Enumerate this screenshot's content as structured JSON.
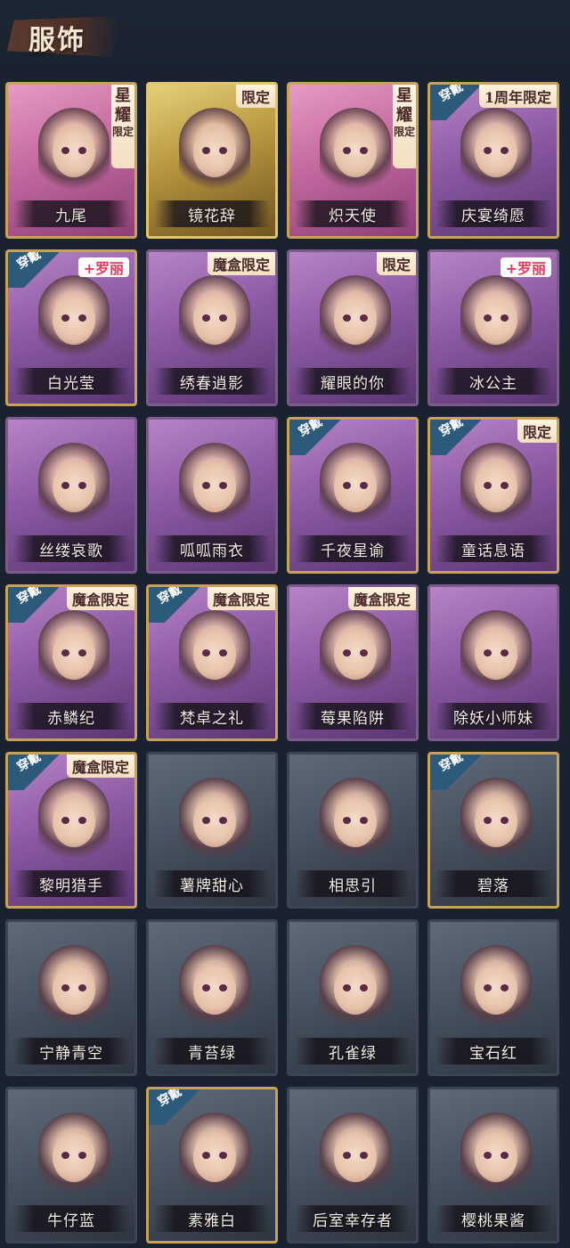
{
  "page": {
    "title": "服饰"
  },
  "cards": [
    {
      "name": "九尾",
      "style": "c-pink",
      "badge": "星耀限定"
    },
    {
      "name": "镜花辞",
      "style": "c-gold",
      "badge": "限定"
    },
    {
      "name": "炽天使",
      "style": "c-pink",
      "badge": "星耀限定"
    },
    {
      "name": "庆宴绮愿",
      "style": "c-purple-gold",
      "badge": "1周年限定",
      "worn": "穿戴"
    },
    {
      "name": "白光莹",
      "style": "c-purple-gold",
      "badge": "+罗丽",
      "worn": "穿戴"
    },
    {
      "name": "绣春逍影",
      "style": "c-purple",
      "badge": "魔盒限定"
    },
    {
      "name": "耀眼的你",
      "style": "c-purple",
      "badge": "限定"
    },
    {
      "name": "冰公主",
      "style": "c-purple",
      "badge": "+罗丽"
    },
    {
      "name": "丝缕哀歌",
      "style": "c-purple"
    },
    {
      "name": "呱呱雨衣",
      "style": "c-purple"
    },
    {
      "name": "千夜星谕",
      "style": "c-purple-gold",
      "worn": "穿戴"
    },
    {
      "name": "童话息语",
      "style": "c-purple-gold",
      "badge": "限定",
      "worn": "穿戴"
    },
    {
      "name": "赤鳞纪",
      "style": "c-purple-gold",
      "badge": "魔盒限定",
      "worn": "穿戴"
    },
    {
      "name": "梵卓之礼",
      "style": "c-purple-gold",
      "badge": "魔盒限定",
      "worn": "穿戴"
    },
    {
      "name": "莓果陷阱",
      "style": "c-purple",
      "badge": "魔盒限定"
    },
    {
      "name": "除妖小师妹",
      "style": "c-purple"
    },
    {
      "name": "黎明猎手",
      "style": "c-purple-gold",
      "badge": "魔盒限定",
      "worn": "穿戴"
    },
    {
      "name": "薯牌甜心",
      "style": "c-gray"
    },
    {
      "name": "相思引",
      "style": "c-gray"
    },
    {
      "name": "碧落",
      "style": "c-gray-gold",
      "worn": "穿戴"
    },
    {
      "name": "宁静青空",
      "style": "c-gray"
    },
    {
      "name": "青苔绿",
      "style": "c-gray"
    },
    {
      "name": "孔雀绿",
      "style": "c-gray"
    },
    {
      "name": "宝石红",
      "style": "c-gray"
    },
    {
      "name": "牛仔蓝",
      "style": "c-gray"
    },
    {
      "name": "素雅白",
      "style": "c-gray-gold",
      "worn": "穿戴"
    },
    {
      "name": "后室幸存者",
      "style": "c-gray"
    },
    {
      "name": "樱桃果酱",
      "style": "c-gray"
    }
  ]
}
